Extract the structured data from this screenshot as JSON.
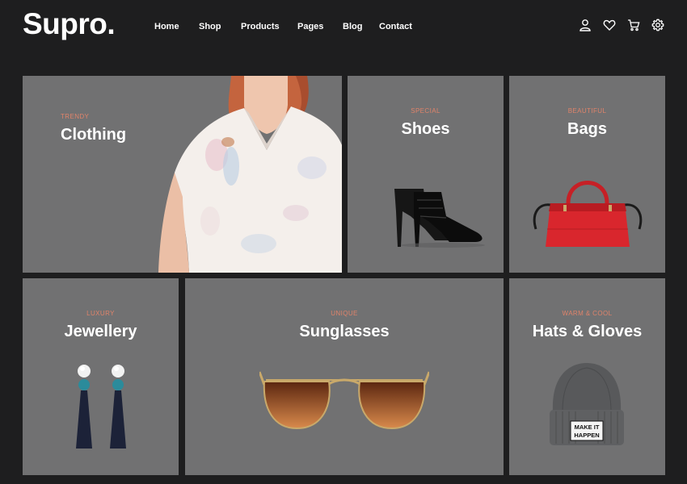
{
  "header": {
    "logo": "Supro.",
    "nav": [
      "Home",
      "Shop",
      "Products",
      "Pages",
      "Blog",
      "Contact"
    ],
    "icons": [
      "user-icon",
      "heart-icon",
      "cart-icon",
      "gear-icon"
    ]
  },
  "categories": [
    {
      "tag": "TRENDY",
      "title": "Clothing"
    },
    {
      "tag": "SPECIAL",
      "title": "Shoes"
    },
    {
      "tag": "BEAUTIFUL",
      "title": "Bags"
    },
    {
      "tag": "LUXURY",
      "title": "Jewellery"
    },
    {
      "tag": "UNIQUE",
      "title": "Sunglasses"
    },
    {
      "tag": "WARM & COOL",
      "title": "Hats & Gloves"
    }
  ],
  "beanie_label": [
    "MAKE IT",
    "HAPPEN"
  ],
  "colors": {
    "page_bg": "#1e1e1f",
    "tile_bg": "#717172",
    "tag_accent": "#e0836a",
    "text": "#ffffff"
  }
}
